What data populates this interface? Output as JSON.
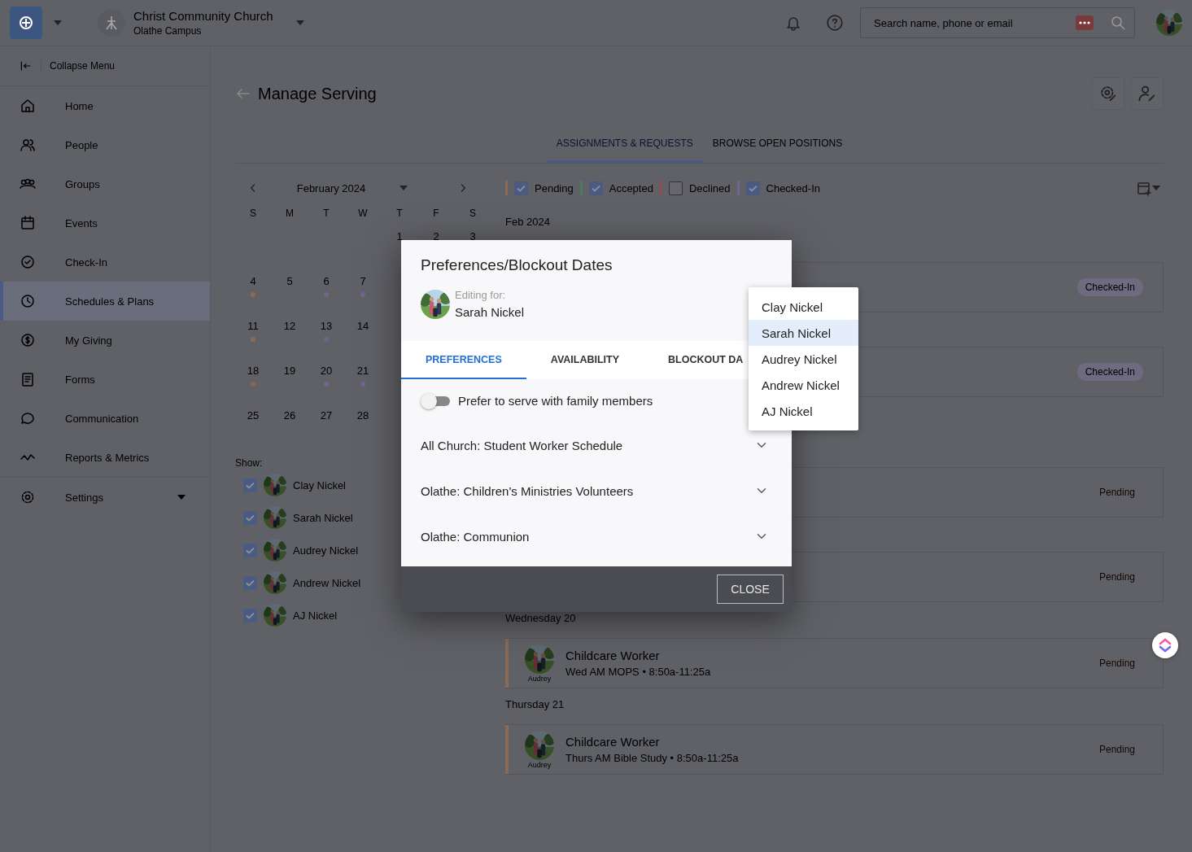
{
  "topbar": {
    "org_name": "Christ Community Church",
    "campus": "Olathe Campus",
    "search": {
      "placeholder": "Search name, phone or email"
    }
  },
  "sidebar": {
    "collapse_label": "Collapse Menu",
    "items": [
      {
        "label": "Home",
        "selected": false,
        "expandable": false
      },
      {
        "label": "People",
        "selected": false,
        "expandable": false
      },
      {
        "label": "Groups",
        "selected": false,
        "expandable": false
      },
      {
        "label": "Events",
        "selected": false,
        "expandable": false
      },
      {
        "label": "Check-In",
        "selected": false,
        "expandable": false
      },
      {
        "label": "Schedules & Plans",
        "selected": true,
        "expandable": false
      },
      {
        "label": "My Giving",
        "selected": false,
        "expandable": false
      },
      {
        "label": "Forms",
        "selected": false,
        "expandable": false
      },
      {
        "label": "Communication",
        "selected": false,
        "expandable": false
      },
      {
        "label": "Reports & Metrics",
        "selected": false,
        "expandable": false
      },
      {
        "label": "Settings",
        "selected": false,
        "expandable": true
      }
    ]
  },
  "page": {
    "title": "Manage Serving",
    "tabs": [
      {
        "label": "ASSIGNMENTS & REQUESTS",
        "selected": true
      },
      {
        "label": "BROWSE OPEN POSITIONS",
        "selected": false
      }
    ]
  },
  "calendar": {
    "month": "February 2024",
    "weekdays": [
      "S",
      "M",
      "T",
      "W",
      "T",
      "F",
      "S"
    ],
    "weeks": [
      [
        {
          "kind": "blank"
        },
        {
          "kind": "blank"
        },
        {
          "kind": "blank"
        },
        {
          "kind": "blank"
        },
        {
          "kind": "day",
          "day": "1"
        },
        {
          "kind": "day",
          "day": "2"
        },
        {
          "kind": "day",
          "day": "3"
        }
      ],
      [
        {
          "kind": "day",
          "day": "4",
          "color": "#8a6a55"
        },
        {
          "kind": "day",
          "day": "5"
        },
        {
          "kind": "day",
          "day": "6",
          "color": "#6e6590"
        },
        {
          "kind": "day",
          "day": "7",
          "color": "#6e6590"
        }
      ],
      [
        {
          "kind": "day",
          "day": "11",
          "color": "#8a6a55"
        },
        {
          "kind": "day",
          "day": "12"
        },
        {
          "kind": "day",
          "day": "13",
          "color": "#6e6590"
        },
        {
          "kind": "day",
          "day": "14"
        }
      ],
      [
        {
          "kind": "day",
          "day": "18",
          "color": "#8a6a55"
        },
        {
          "kind": "day",
          "day": "19"
        },
        {
          "kind": "day",
          "day": "20",
          "color": "#6e6590"
        },
        {
          "kind": "day",
          "day": "21",
          "color": "#6e6590"
        }
      ],
      [
        {
          "kind": "day",
          "day": "25"
        },
        {
          "kind": "day",
          "day": "26"
        },
        {
          "kind": "day",
          "day": "27"
        },
        {
          "kind": "day",
          "day": "28"
        }
      ]
    ]
  },
  "show": {
    "label": "Show:",
    "members": [
      {
        "name": "Clay Nickel",
        "checked": true
      },
      {
        "name": "Sarah Nickel",
        "checked": true
      },
      {
        "name": "Audrey Nickel",
        "checked": true
      },
      {
        "name": "Andrew Nickel",
        "checked": true
      },
      {
        "name": "AJ Nickel",
        "checked": true
      }
    ]
  },
  "legend": [
    {
      "label": "Pending",
      "color": "#8a6a55",
      "checked": true
    },
    {
      "label": "Accepted",
      "color": "#4f7a5e",
      "checked": true
    },
    {
      "label": "Declined",
      "color": "#8c5050",
      "checked": false
    },
    {
      "label": "Checked-In",
      "color": "#6e6590",
      "checked": true
    }
  ],
  "schedule": {
    "month": "Feb 2024",
    "items": [
      {
        "kind": "card",
        "status": "Checked-In",
        "badge": true
      },
      {
        "kind": "card",
        "status": "Checked-In",
        "badge": true
      },
      {
        "kind": "card",
        "status": "Pending",
        "badge": false
      },
      {
        "kind": "card",
        "status": "Pending",
        "badge": false
      },
      {
        "kind": "heading",
        "text": "Wednesday 20"
      },
      {
        "kind": "card",
        "title": "Childcare Worker",
        "detail": "Wed AM MOPS • 8:50a-11:25a",
        "person": "Audrey",
        "status": "Pending",
        "badge": false,
        "color": "#8a6a55"
      },
      {
        "kind": "heading",
        "text": "Thursday 21"
      },
      {
        "kind": "card",
        "title": "Childcare Worker",
        "detail": "Thurs AM Bible Study • 8:50a-11:25a",
        "person": "Audrey",
        "status": "Pending",
        "badge": false,
        "color": "#8a6a55"
      }
    ]
  },
  "modal": {
    "title": "Preferences/Blockout Dates",
    "editing_label": "Editing for:",
    "editing_name": "Sarah Nickel",
    "tabs": [
      {
        "label": "PREFERENCES",
        "selected": true
      },
      {
        "label": "AVAILABILITY",
        "selected": false
      },
      {
        "label": "BLOCKOUT DA",
        "selected": false
      }
    ],
    "toggle": {
      "label": "Prefer to serve with family members",
      "on": false
    },
    "sections": [
      {
        "label": "All Church: Student Worker Schedule",
        "expanded": false
      },
      {
        "label": "Olathe: Children's Ministries Volunteers",
        "expanded": false
      },
      {
        "label": "Olathe: Communion",
        "expanded": false
      }
    ],
    "close_button": "CLOSE"
  },
  "dropdown": {
    "options": [
      {
        "label": "Clay Nickel",
        "selected": false
      },
      {
        "label": "Sarah Nickel",
        "selected": true
      },
      {
        "label": "Audrey Nickel",
        "selected": false
      },
      {
        "label": "Andrew Nickel",
        "selected": false
      },
      {
        "label": "AJ Nickel",
        "selected": false
      }
    ]
  }
}
